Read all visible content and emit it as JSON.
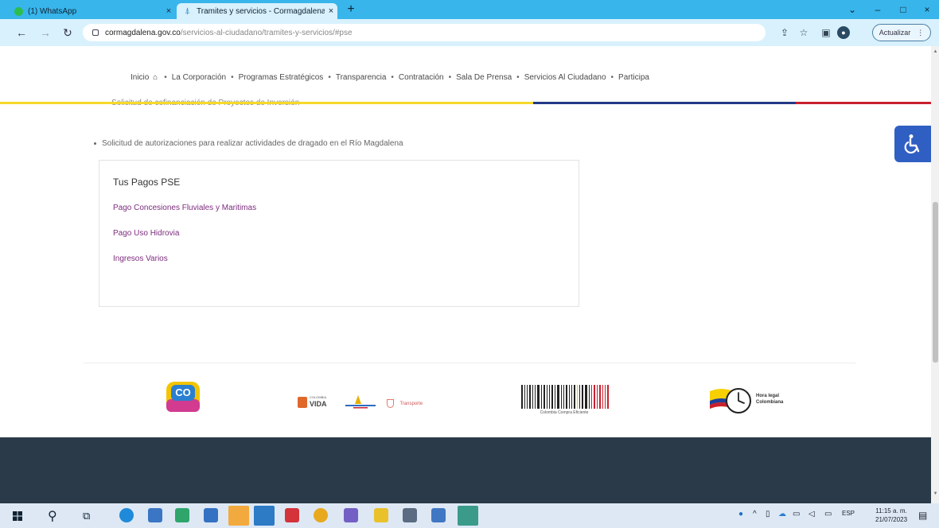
{
  "browser": {
    "tabs": [
      {
        "label": "(1) WhatsApp",
        "close": "×"
      },
      {
        "label": "Tramites y servicios - Cormagdalena",
        "close": "×"
      }
    ],
    "new_tab": "+",
    "window_controls": [
      "⌄",
      "–",
      "□",
      "×"
    ],
    "url_host": "cormagdalena.gov.co",
    "url_path": "/servicios-al-ciudadano/tramites-y-servicios/#pse",
    "update_label": "Actualizar"
  },
  "nav": {
    "items": [
      "Inicio",
      "La Corporación",
      "Programas Estratégicos",
      "Transparencia",
      "Contratación",
      "Sala De Prensa",
      "Servicios Al Ciudadano",
      "Participa"
    ],
    "separator": "•"
  },
  "content": {
    "clipped_line": "Solicitud de cofinanciación de Proyectos de Inversión",
    "bullet_item": "Solicitud de autorizaciones para realizar actividades de dragado en el Río Magdalena"
  },
  "pse": {
    "title": "Tus Pagos PSE",
    "links": [
      "Pago Concesiones Fluviales y Maritimas",
      "Pago Uso Hidrovia",
      "Ingresos Varios"
    ]
  },
  "footer": {
    "logo_co": "CO",
    "logo_vida_small": "COLOMBIA",
    "logo_vida": "VIDA",
    "logo_transporte": "Transporte",
    "logo_compra": "Colombia Compra Eficiente",
    "logo_hora_1": "Hora legal",
    "logo_hora_2": "Colombiana"
  },
  "taskbar": {
    "tray_lang": "ESP",
    "time": "11:15 a. m.",
    "date": "21/07/2023"
  },
  "colors": {
    "chrome_tab": "#38b5ea",
    "toolbar": "#d8f1fd",
    "link": "#7d2c7d",
    "stripe_yellow": "#f6d92a",
    "stripe_blue": "#243a86",
    "stripe_red": "#c8202f",
    "accessibility": "#2f5fc2",
    "dark_band": "#2a3a48"
  }
}
